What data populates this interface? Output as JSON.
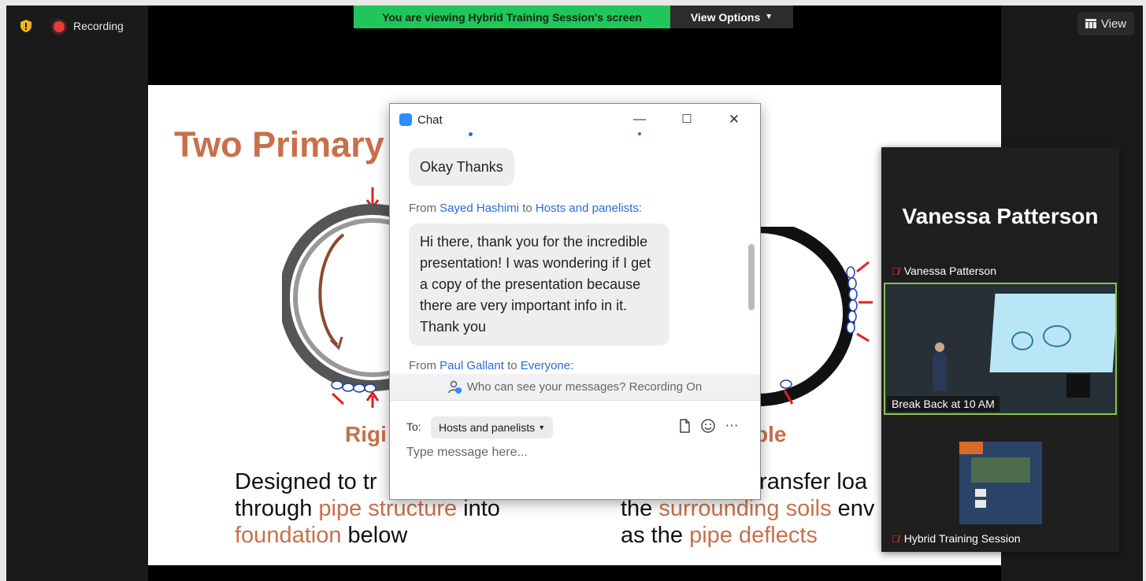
{
  "toolbar": {
    "recording_label": "Recording",
    "view_label": "View"
  },
  "banner": {
    "viewing_text": "You are viewing Hybrid Training Session's screen",
    "view_options_label": "View Options"
  },
  "slide": {
    "title": "Two Primary",
    "label_left": "Rigi",
    "label_right": "ble",
    "left_text": [
      {
        "parts": [
          "Designed to tr"
        ]
      },
      {
        "parts": [
          "through ",
          "pipe structure",
          " into"
        ]
      },
      {
        "parts": [
          "foundation",
          " below"
        ]
      }
    ],
    "right_text_line1": "transfer loa",
    "right_text_line2_a": "the ",
    "right_text_line2_b": "surrounding soils",
    "right_text_line2_c": " env",
    "right_text_line3_a": "as the ",
    "right_text_line3_b": "pipe deflects"
  },
  "chat": {
    "title": "Chat",
    "messages": [
      {
        "text": "Okay Thanks"
      },
      {
        "from_prefix": "From",
        "sender": "Sayed Hashimi",
        "to_word": "to",
        "recipient": "Hosts and panelists:",
        "text": "Hi there, thank you for the incredible presentation! I was wondering if I get a copy of the presentation because there are very important info in it. Thank you"
      },
      {
        "from_prefix": "From",
        "sender": "Paul Gallant",
        "to_word": "to",
        "recipient": "Everyone:"
      }
    ],
    "who_can_see": "Who can see your messages? Recording On",
    "to_label": "To:",
    "to_value": "Hosts and panelists",
    "input_placeholder": "Type message here...",
    "icons": [
      "file-icon",
      "emoji-icon",
      "more-icon"
    ]
  },
  "panel": {
    "big_name": "Vanessa Patterson",
    "tile1_name": "Vanessa Patterson",
    "video_caption": "Break Back at 10 AM",
    "tile3_name": "Hybrid Training Session"
  },
  "colors": {
    "banner_green": "#21c65a",
    "slide_accent": "#c8704a",
    "link_blue": "#2d6ad6",
    "active_speaker_border": "#8bc34a",
    "recording_red": "#e83a3a"
  }
}
